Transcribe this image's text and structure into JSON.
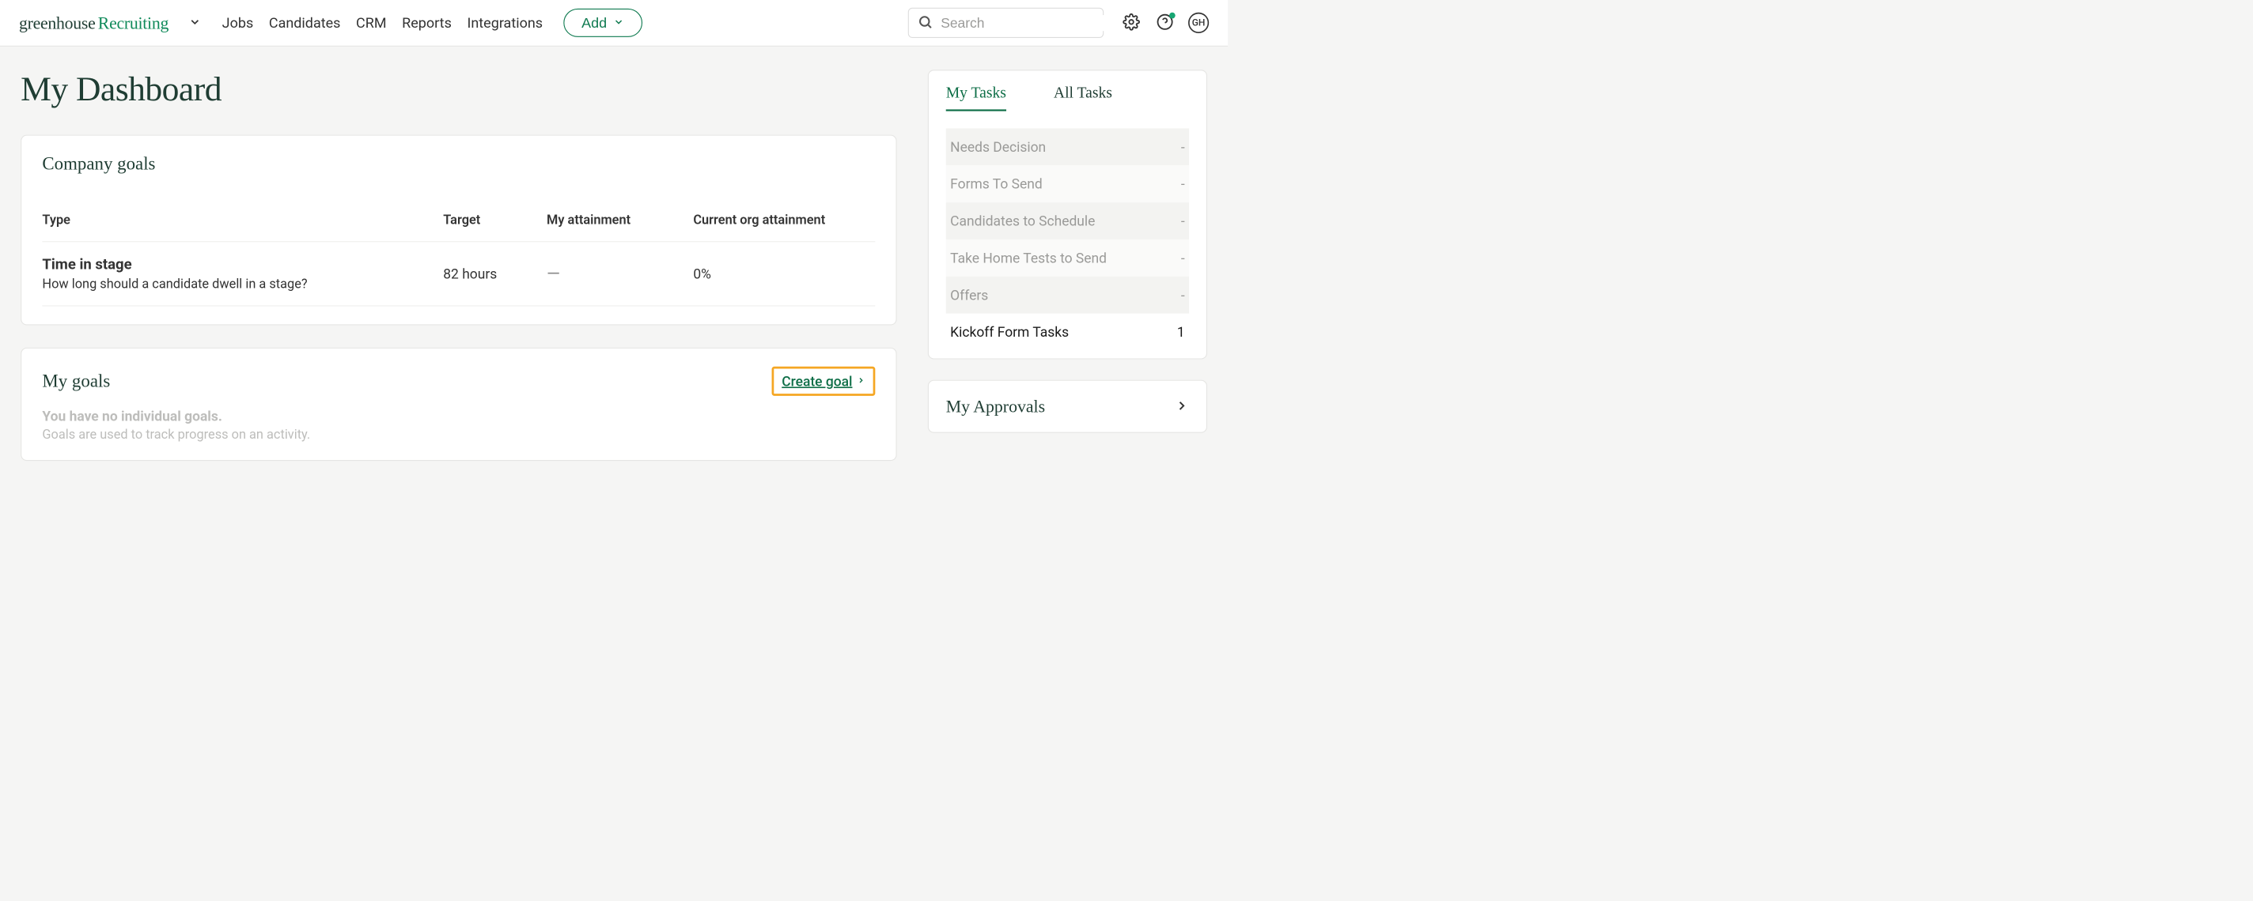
{
  "brand": {
    "part1": "greenhouse",
    "part2": "Recruiting"
  },
  "nav": {
    "links": [
      "Jobs",
      "Candidates",
      "CRM",
      "Reports",
      "Integrations"
    ],
    "add_label": "Add"
  },
  "search": {
    "placeholder": "Search"
  },
  "avatar_initials": "GH",
  "page_title": "My Dashboard",
  "company_goals": {
    "title": "Company goals",
    "headers": {
      "type": "Type",
      "target": "Target",
      "my_attainment": "My attainment",
      "org_attainment": "Current org attainment"
    },
    "rows": [
      {
        "name": "Time in stage",
        "desc": "How long should a candidate dwell in a stage?",
        "target": "82 hours",
        "my_attainment": "—",
        "org_attainment": "0%"
      }
    ]
  },
  "my_goals": {
    "title": "My goals",
    "create_label": "Create goal",
    "empty_title": "You have no individual goals.",
    "empty_sub": "Goals are used to track progress on an activity."
  },
  "tasks": {
    "tabs": {
      "mine": "My Tasks",
      "all": "All Tasks"
    },
    "items": [
      {
        "label": "Needs Decision",
        "count": "-",
        "active": false
      },
      {
        "label": "Forms To Send",
        "count": "-",
        "active": false
      },
      {
        "label": "Candidates to Schedule",
        "count": "-",
        "active": false
      },
      {
        "label": "Take Home Tests to Send",
        "count": "-",
        "active": false
      },
      {
        "label": "Offers",
        "count": "-",
        "active": false
      },
      {
        "label": "Kickoff Form Tasks",
        "count": "1",
        "active": true
      }
    ]
  },
  "approvals": {
    "title": "My Approvals"
  }
}
